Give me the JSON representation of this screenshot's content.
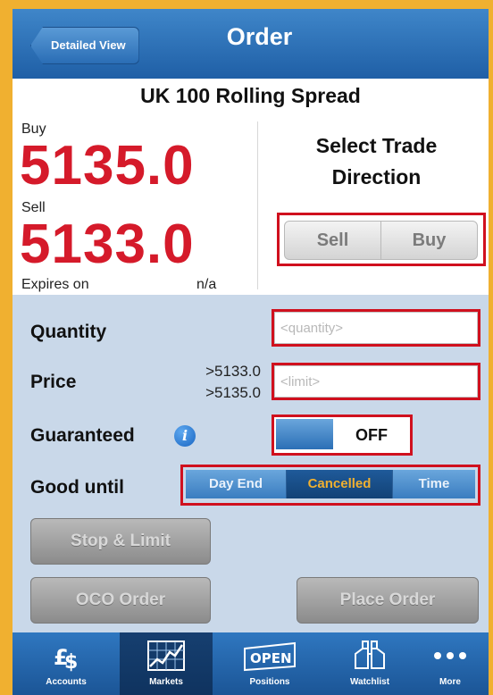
{
  "header": {
    "back_label": "Detailed View",
    "title": "Order"
  },
  "market": {
    "name": "UK 100 Rolling Spread",
    "buy_label": "Buy",
    "buy_price": "5135.0",
    "sell_label": "Sell",
    "sell_price": "5133.0",
    "expires_label": "Expires on",
    "expires_value": "n/a",
    "direction_title": "Select Trade Direction",
    "direction_options": [
      "Sell",
      "Buy"
    ]
  },
  "form": {
    "quantity_label": "Quantity",
    "quantity_placeholder": "<quantity>",
    "price_label": "Price",
    "price_ref_1": ">5133.0",
    "price_ref_2": ">5135.0",
    "limit_placeholder": "<limit>",
    "guaranteed_label": "Guaranteed",
    "guaranteed_value": "OFF",
    "good_until_label": "Good until",
    "good_until_options": [
      "Day End",
      "Cancelled",
      "Time"
    ],
    "good_until_selected": "Cancelled"
  },
  "buttons": {
    "stop_limit": "Stop & Limit",
    "oco_order": "OCO Order",
    "place_order": "Place Order"
  },
  "tabbar": {
    "tabs": [
      {
        "label": "Accounts",
        "icon": "currency-icon"
      },
      {
        "label": "Markets",
        "icon": "chart-icon"
      },
      {
        "label": "Positions",
        "icon": "open-sign-icon"
      },
      {
        "label": "Watchlist",
        "icon": "binoculars-icon"
      },
      {
        "label": "More",
        "icon": "more-icon"
      }
    ],
    "selected": "Markets",
    "open_text": "OPEN"
  },
  "colors": {
    "price_red": "#d51a2a",
    "header_blue": "#2a6db5",
    "highlight_red": "#d0101e",
    "form_bg": "#c9d8e9"
  }
}
